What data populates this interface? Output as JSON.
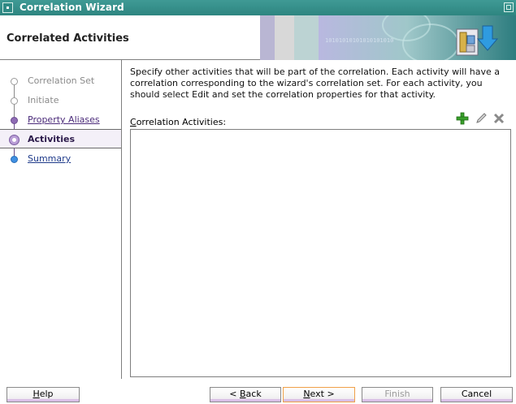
{
  "window": {
    "title": "Correlation Wizard",
    "title_bar_color": "#2e8580",
    "system_icon": "window-menu-icon",
    "maximize_icon": "maximize-icon"
  },
  "header": {
    "title": "Correlated Activities",
    "banner_binary_text": "10101010101010101010",
    "banner_icon": "wizard-download-icon"
  },
  "nav": {
    "steps": [
      {
        "label": "Correlation Set",
        "state": "disabled"
      },
      {
        "label": "Initiate",
        "state": "disabled"
      },
      {
        "label": "Property Aliases",
        "state": "visited"
      },
      {
        "label": "Activities",
        "state": "current"
      },
      {
        "label": "Summary",
        "state": "next"
      }
    ]
  },
  "main": {
    "description": "Specify other activities that will be part of the correlation. Each activity will have a correlation corresponding to the wizard's correlation set. For each activity, you should select Edit and set the correlation properties for that activity.",
    "list_label_mnemonic": "C",
    "list_label_rest": "orrelation Activities:",
    "toolbar": {
      "add_icon": "add-icon",
      "edit_icon": "edit-pencil-icon",
      "delete_icon": "delete-icon"
    },
    "activities": []
  },
  "buttons": {
    "help_mnemonic": "H",
    "help_rest": "elp",
    "back_prefix": "< ",
    "back_mnemonic": "B",
    "back_rest": "ack",
    "next_mnemonic": "N",
    "next_rest": "ext >",
    "finish": "Finish",
    "cancel": "Cancel"
  },
  "colors": {
    "accent_purple": "#8e6bb4",
    "link_blue": "#3f8fe2",
    "focus_border": "#f0a048"
  }
}
